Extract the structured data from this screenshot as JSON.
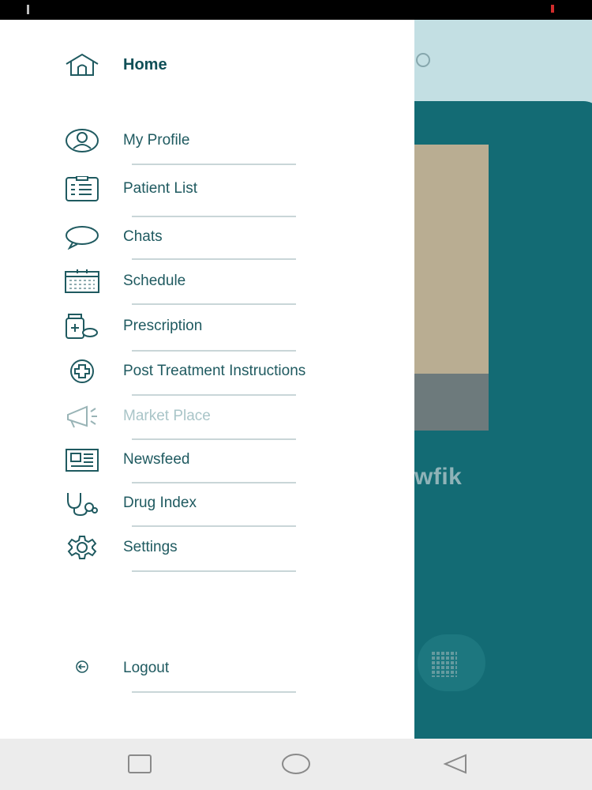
{
  "drawer": {
    "items": [
      {
        "label": "Home",
        "icon": "home-icon",
        "active": true
      },
      {
        "label": "My Profile",
        "icon": "profile-icon"
      },
      {
        "label": "Patient List",
        "icon": "clipboard-list-icon"
      },
      {
        "label": "Chats",
        "icon": "chat-bubble-icon"
      },
      {
        "label": "Schedule",
        "icon": "calendar-icon"
      },
      {
        "label": "Prescription",
        "icon": "medicine-bottle-icon"
      },
      {
        "label": "Post Treatment Instructions",
        "icon": "plus-circle-icon"
      },
      {
        "label": "Market Place",
        "icon": "megaphone-icon",
        "disabled": true
      },
      {
        "label": "Newsfeed",
        "icon": "newspaper-icon"
      },
      {
        "label": "Drug Index",
        "icon": "stethoscope-icon"
      },
      {
        "label": "Settings",
        "icon": "gear-icon"
      }
    ],
    "logout": {
      "label": "Logout",
      "icon": "logout-icon"
    }
  },
  "background_app": {
    "name_fragment": "wfik"
  },
  "colors": {
    "accent": "#136b74",
    "text": "#1f5a60",
    "disabled_text": "#a9c5c8"
  },
  "navbar": {
    "buttons": [
      "recent-apps-button",
      "home-button",
      "back-button"
    ]
  }
}
